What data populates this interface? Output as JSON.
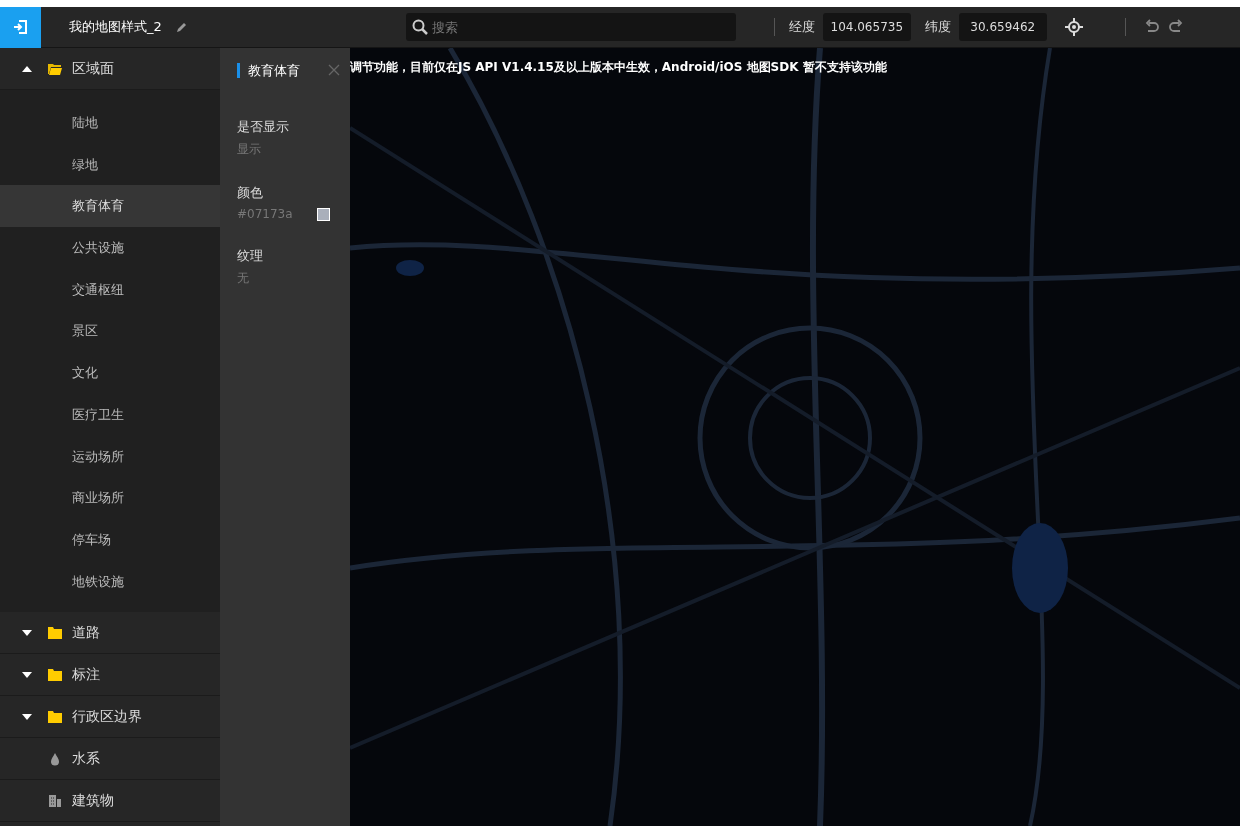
{
  "toolbar": {
    "title": "我的地图样式_2",
    "search": {
      "placeholder": "搜索"
    },
    "longitude": {
      "label": "经度",
      "value": "104.065735"
    },
    "latitude": {
      "label": "纬度",
      "value": "30.659462"
    }
  },
  "sidebar": {
    "groups": [
      {
        "label": "区域面",
        "kind": "folder",
        "expanded": true,
        "children": [
          {
            "label": "陆地",
            "selected": false
          },
          {
            "label": "绿地",
            "selected": false
          },
          {
            "label": "教育体育",
            "selected": true
          },
          {
            "label": "公共设施",
            "selected": false
          },
          {
            "label": "交通枢纽",
            "selected": false
          },
          {
            "label": "景区",
            "selected": false
          },
          {
            "label": "文化",
            "selected": false
          },
          {
            "label": "医疗卫生",
            "selected": false
          },
          {
            "label": "运动场所",
            "selected": false
          },
          {
            "label": "商业场所",
            "selected": false
          },
          {
            "label": "停车场",
            "selected": false
          },
          {
            "label": "地铁设施",
            "selected": false
          }
        ]
      },
      {
        "label": "道路",
        "kind": "folder",
        "expanded": false
      },
      {
        "label": "标注",
        "kind": "folder",
        "expanded": false
      },
      {
        "label": "行政区边界",
        "kind": "folder",
        "expanded": false
      },
      {
        "label": "水系",
        "kind": "water"
      },
      {
        "label": "建筑物",
        "kind": "building"
      }
    ]
  },
  "panel": {
    "title": "教育体育",
    "fields": [
      {
        "label": "是否显示",
        "value": "显示"
      },
      {
        "label": "颜色",
        "value": "#07173a",
        "color": "#a9afbb"
      },
      {
        "label": "纹理",
        "value": "无"
      }
    ]
  },
  "map": {
    "notice": "调节功能，目前仅在JS API V1.4.15及以上版本中生效，Android/iOS 地图SDK 暂不支持该功能"
  }
}
